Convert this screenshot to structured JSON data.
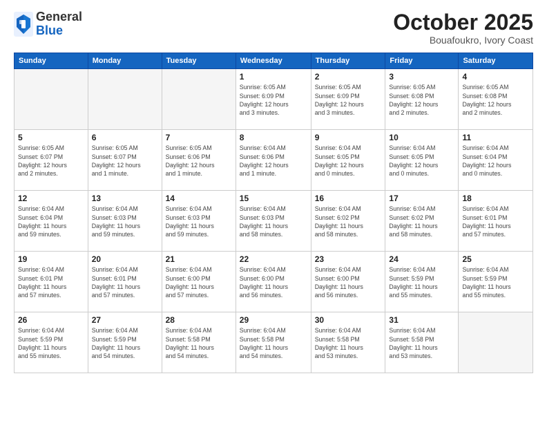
{
  "header": {
    "logo_general": "General",
    "logo_blue": "Blue",
    "month_title": "October 2025",
    "subtitle": "Bouafoukro, Ivory Coast"
  },
  "weekdays": [
    "Sunday",
    "Monday",
    "Tuesday",
    "Wednesday",
    "Thursday",
    "Friday",
    "Saturday"
  ],
  "weeks": [
    [
      {
        "day": "",
        "info": ""
      },
      {
        "day": "",
        "info": ""
      },
      {
        "day": "",
        "info": ""
      },
      {
        "day": "1",
        "info": "Sunrise: 6:05 AM\nSunset: 6:09 PM\nDaylight: 12 hours\nand 3 minutes."
      },
      {
        "day": "2",
        "info": "Sunrise: 6:05 AM\nSunset: 6:09 PM\nDaylight: 12 hours\nand 3 minutes."
      },
      {
        "day": "3",
        "info": "Sunrise: 6:05 AM\nSunset: 6:08 PM\nDaylight: 12 hours\nand 2 minutes."
      },
      {
        "day": "4",
        "info": "Sunrise: 6:05 AM\nSunset: 6:08 PM\nDaylight: 12 hours\nand 2 minutes."
      }
    ],
    [
      {
        "day": "5",
        "info": "Sunrise: 6:05 AM\nSunset: 6:07 PM\nDaylight: 12 hours\nand 2 minutes."
      },
      {
        "day": "6",
        "info": "Sunrise: 6:05 AM\nSunset: 6:07 PM\nDaylight: 12 hours\nand 1 minute."
      },
      {
        "day": "7",
        "info": "Sunrise: 6:05 AM\nSunset: 6:06 PM\nDaylight: 12 hours\nand 1 minute."
      },
      {
        "day": "8",
        "info": "Sunrise: 6:04 AM\nSunset: 6:06 PM\nDaylight: 12 hours\nand 1 minute."
      },
      {
        "day": "9",
        "info": "Sunrise: 6:04 AM\nSunset: 6:05 PM\nDaylight: 12 hours\nand 0 minutes."
      },
      {
        "day": "10",
        "info": "Sunrise: 6:04 AM\nSunset: 6:05 PM\nDaylight: 12 hours\nand 0 minutes."
      },
      {
        "day": "11",
        "info": "Sunrise: 6:04 AM\nSunset: 6:04 PM\nDaylight: 12 hours\nand 0 minutes."
      }
    ],
    [
      {
        "day": "12",
        "info": "Sunrise: 6:04 AM\nSunset: 6:04 PM\nDaylight: 11 hours\nand 59 minutes."
      },
      {
        "day": "13",
        "info": "Sunrise: 6:04 AM\nSunset: 6:03 PM\nDaylight: 11 hours\nand 59 minutes."
      },
      {
        "day": "14",
        "info": "Sunrise: 6:04 AM\nSunset: 6:03 PM\nDaylight: 11 hours\nand 59 minutes."
      },
      {
        "day": "15",
        "info": "Sunrise: 6:04 AM\nSunset: 6:03 PM\nDaylight: 11 hours\nand 58 minutes."
      },
      {
        "day": "16",
        "info": "Sunrise: 6:04 AM\nSunset: 6:02 PM\nDaylight: 11 hours\nand 58 minutes."
      },
      {
        "day": "17",
        "info": "Sunrise: 6:04 AM\nSunset: 6:02 PM\nDaylight: 11 hours\nand 58 minutes."
      },
      {
        "day": "18",
        "info": "Sunrise: 6:04 AM\nSunset: 6:01 PM\nDaylight: 11 hours\nand 57 minutes."
      }
    ],
    [
      {
        "day": "19",
        "info": "Sunrise: 6:04 AM\nSunset: 6:01 PM\nDaylight: 11 hours\nand 57 minutes."
      },
      {
        "day": "20",
        "info": "Sunrise: 6:04 AM\nSunset: 6:01 PM\nDaylight: 11 hours\nand 57 minutes."
      },
      {
        "day": "21",
        "info": "Sunrise: 6:04 AM\nSunset: 6:00 PM\nDaylight: 11 hours\nand 57 minutes."
      },
      {
        "day": "22",
        "info": "Sunrise: 6:04 AM\nSunset: 6:00 PM\nDaylight: 11 hours\nand 56 minutes."
      },
      {
        "day": "23",
        "info": "Sunrise: 6:04 AM\nSunset: 6:00 PM\nDaylight: 11 hours\nand 56 minutes."
      },
      {
        "day": "24",
        "info": "Sunrise: 6:04 AM\nSunset: 5:59 PM\nDaylight: 11 hours\nand 55 minutes."
      },
      {
        "day": "25",
        "info": "Sunrise: 6:04 AM\nSunset: 5:59 PM\nDaylight: 11 hours\nand 55 minutes."
      }
    ],
    [
      {
        "day": "26",
        "info": "Sunrise: 6:04 AM\nSunset: 5:59 PM\nDaylight: 11 hours\nand 55 minutes."
      },
      {
        "day": "27",
        "info": "Sunrise: 6:04 AM\nSunset: 5:59 PM\nDaylight: 11 hours\nand 54 minutes."
      },
      {
        "day": "28",
        "info": "Sunrise: 6:04 AM\nSunset: 5:58 PM\nDaylight: 11 hours\nand 54 minutes."
      },
      {
        "day": "29",
        "info": "Sunrise: 6:04 AM\nSunset: 5:58 PM\nDaylight: 11 hours\nand 54 minutes."
      },
      {
        "day": "30",
        "info": "Sunrise: 6:04 AM\nSunset: 5:58 PM\nDaylight: 11 hours\nand 53 minutes."
      },
      {
        "day": "31",
        "info": "Sunrise: 6:04 AM\nSunset: 5:58 PM\nDaylight: 11 hours\nand 53 minutes."
      },
      {
        "day": "",
        "info": ""
      }
    ]
  ]
}
